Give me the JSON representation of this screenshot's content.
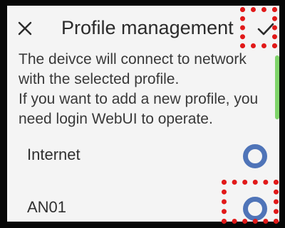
{
  "header": {
    "close_icon": "close-icon",
    "title": "Profile management",
    "confirm_icon": "checkmark-icon"
  },
  "description": {
    "lines": [
      "The deivce will connect to network",
      "with the selected profile.",
      "If you want to add a new profile, you",
      "need login WebUI to operate."
    ]
  },
  "profiles": [
    {
      "label": "Internet",
      "selected": false
    },
    {
      "label": "AN01",
      "selected": false
    }
  ],
  "colors": {
    "radio": "#4f74b8",
    "highlight": "#e11919",
    "accent_tab": "#7fd46a"
  }
}
